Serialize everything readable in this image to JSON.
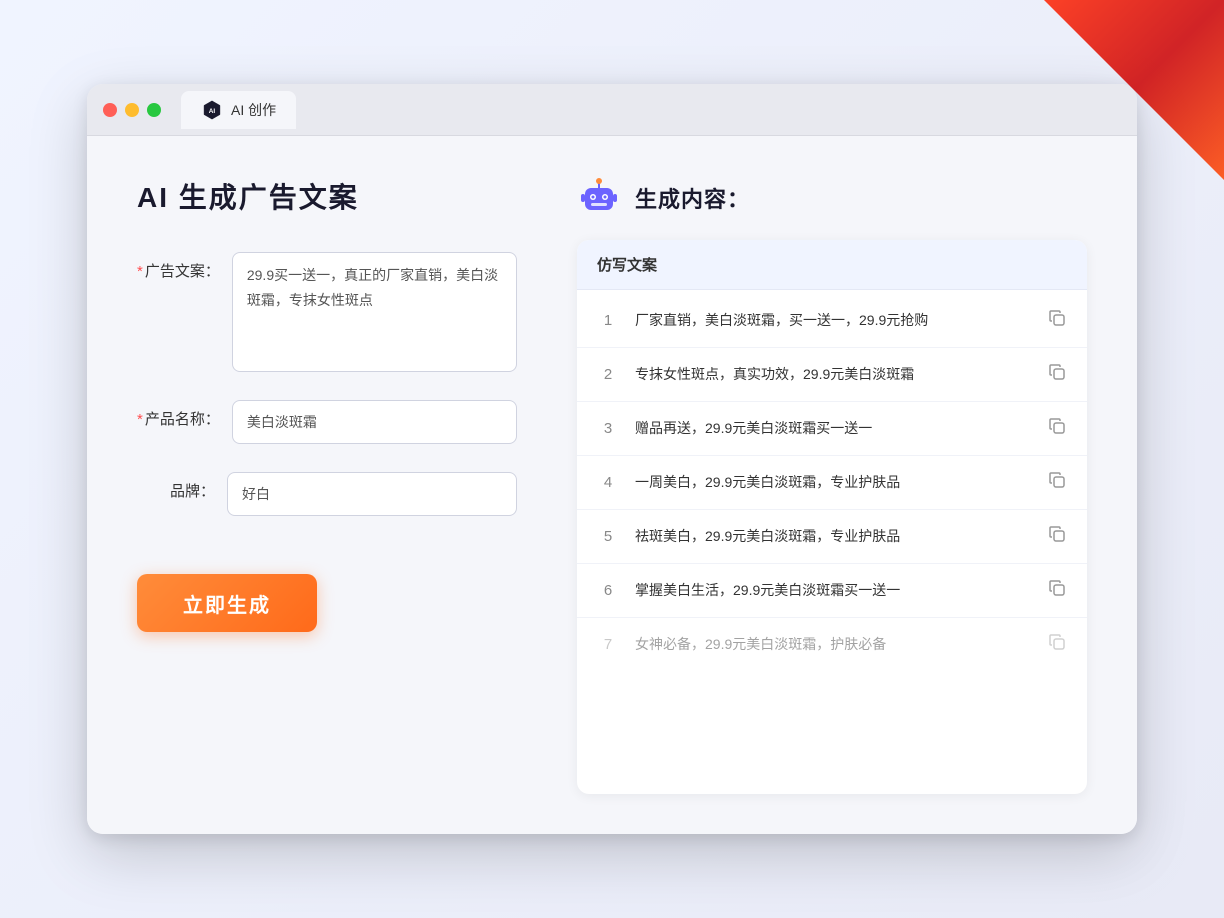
{
  "decoration": {
    "corner": "red-corner"
  },
  "browser": {
    "controls": {
      "close": "close",
      "minimize": "minimize",
      "maximize": "maximize"
    },
    "tab": {
      "label": "AI 创作"
    }
  },
  "page": {
    "title": "AI 生成广告文案",
    "form": {
      "ad_copy_label": "广告文案：",
      "ad_copy_required": "*",
      "ad_copy_value": "29.9买一送一，真正的厂家直销，美白淡斑霜，专抹女性斑点",
      "product_name_label": "产品名称：",
      "product_name_required": "*",
      "product_name_value": "美白淡斑霜",
      "brand_label": "品牌：",
      "brand_value": "好白",
      "generate_button": "立即生成"
    },
    "result": {
      "robot_label": "AI机器人图标",
      "title": "生成内容：",
      "column_header": "仿写文案",
      "items": [
        {
          "number": "1",
          "text": "厂家直销，美白淡斑霜，买一送一，29.9元抢购",
          "faded": false
        },
        {
          "number": "2",
          "text": "专抹女性斑点，真实功效，29.9元美白淡斑霜",
          "faded": false
        },
        {
          "number": "3",
          "text": "赠品再送，29.9元美白淡斑霜买一送一",
          "faded": false
        },
        {
          "number": "4",
          "text": "一周美白，29.9元美白淡斑霜，专业护肤品",
          "faded": false
        },
        {
          "number": "5",
          "text": "祛斑美白，29.9元美白淡斑霜，专业护肤品",
          "faded": false
        },
        {
          "number": "6",
          "text": "掌握美白生活，29.9元美白淡斑霜买一送一",
          "faded": false
        },
        {
          "number": "7",
          "text": "女神必备，29.9元美白淡斑霜，护肤必备",
          "faded": true
        }
      ]
    }
  }
}
